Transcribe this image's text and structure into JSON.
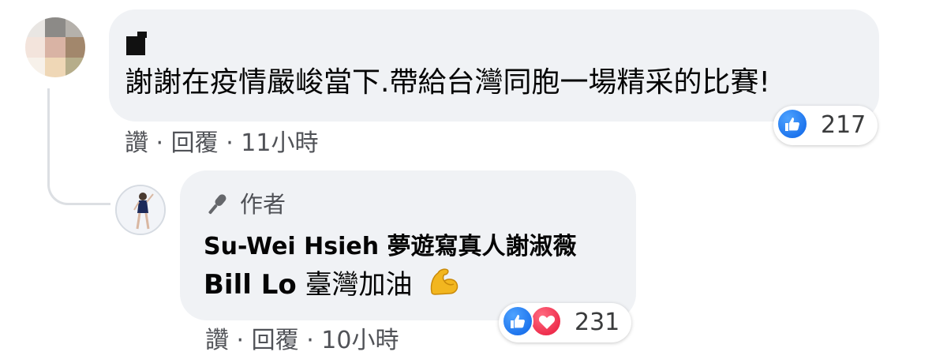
{
  "comment": {
    "text": "謝謝在疫情嚴峻當下.帶給台灣同胞一場精采的比賽!",
    "reaction_count": "217",
    "meta": {
      "like": "讚",
      "reply": "回覆",
      "time": "11小時",
      "sep1": "·",
      "sep2": "·"
    }
  },
  "reply": {
    "author_badge": "作者",
    "mention_line": "Su-Wei Hsieh 夢遊寫真人謝淑薇",
    "mention_name": "Bill Lo",
    "text": "臺灣加油",
    "emoji": "flexed-biceps",
    "reaction_count": "231",
    "meta": {
      "like": "讚",
      "reply": "回覆",
      "time": "10小時",
      "sep1": "·",
      "sep2": "·"
    }
  },
  "colors": {
    "bubble": "#f0f2f5",
    "like_blue": "#1877f2",
    "love_red": "#f33e58",
    "meta_gray": "#505257"
  }
}
